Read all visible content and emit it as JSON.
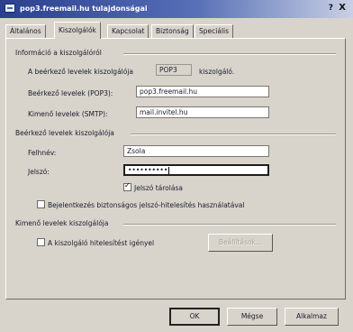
{
  "window": {
    "title": "pop3.freemail.hu tulajdonságai",
    "help_label": "?",
    "close_label": "X"
  },
  "tabs": [
    {
      "label": "Általános",
      "active": false
    },
    {
      "label": "Kiszolgálók",
      "active": true
    },
    {
      "label": "Kapcsolat",
      "active": false
    },
    {
      "label": "Biztonság",
      "active": false
    },
    {
      "label": "Speciális",
      "active": false
    }
  ],
  "server_info": {
    "section_title": "Információ a kiszolgálóról",
    "incoming_type_label": "A beérkező levelek kiszolgálója",
    "incoming_type_value": "POP3",
    "incoming_type_suffix": "kiszolgáló.",
    "incoming_label": "Beérkező levelek (POP3):",
    "incoming_value": "pop3.freemail.hu",
    "outgoing_label": "Kimenő levelek (SMTP):",
    "outgoing_value": "mail.invitel.hu"
  },
  "incoming_server": {
    "section_title": "Beérkező levelek kiszolgálója",
    "username_label": "Felhnév:",
    "username_value": "Zsola",
    "password_label": "Jelszó:",
    "password_value": "••••••••••",
    "remember_password_label": "Jelszó tárolása",
    "remember_password_checked": true,
    "spa_label": "Bejelentkezés biztonságos jelszó-hitelesítés használatával",
    "spa_checked": false
  },
  "outgoing_server": {
    "section_title": "Kimenő levelek kiszolgálója",
    "auth_label": "A kiszolgáló hitelesítést igényel",
    "auth_checked": false,
    "settings_button": "Beállítások..."
  },
  "footer": {
    "ok": "OK",
    "cancel": "Mégse",
    "apply": "Alkalmaz"
  }
}
